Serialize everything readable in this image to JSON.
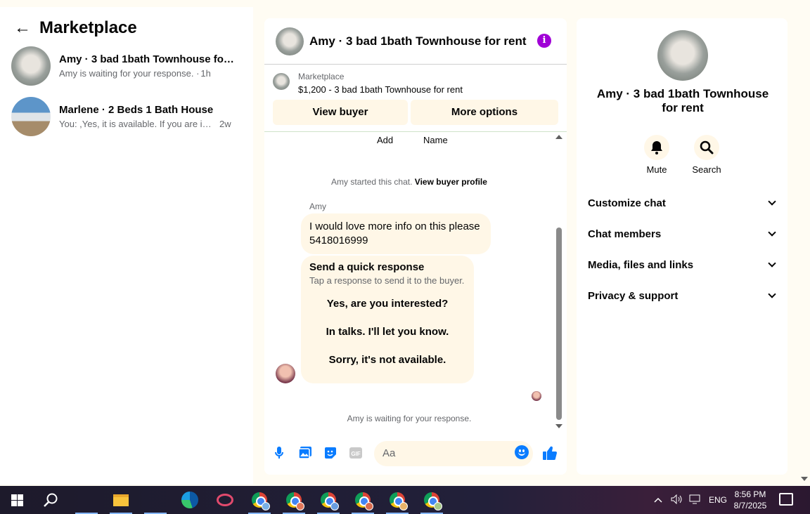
{
  "sidebar": {
    "title": "Marketplace",
    "conversations": [
      {
        "title": "Amy · 3 bad 1bath Townhouse for ...",
        "snippet": "Amy is waiting for your response. ·",
        "ago": "1h"
      },
      {
        "title": "Marlene · 2 Beds 1 Bath House",
        "snippet": "You: ,Yes, it is available. If you are inte...",
        "ago": "2w"
      }
    ]
  },
  "chat": {
    "title": "Amy · 3 bad 1bath Townhouse for rent",
    "info_icon_glyph": "i",
    "marketplace_label": "Marketplace",
    "listing": "$1,200 - 3 bad 1bath Townhouse for rent",
    "view_buyer_label": "View buyer",
    "more_options_label": "More options",
    "col_add": "Add",
    "col_name": "Name",
    "started_text": "Amy started this chat.",
    "view_profile_link": "View buyer profile",
    "sender_name": "Amy",
    "message_line1": "I would love more info on this please",
    "message_line2": "5418016999",
    "quick_title": "Send a quick response",
    "quick_subtitle": "Tap a response to send it to the buyer.",
    "quick_options": [
      "Yes, are you interested?",
      "In talks. I'll let you know.",
      "Sorry, it's not available."
    ],
    "waiting_text": "Amy is waiting for your response.",
    "composer_placeholder": "Aa"
  },
  "info_panel": {
    "title": "Amy · 3 bad 1bath Townhouse for rent",
    "mute_label": "Mute",
    "search_label": "Search",
    "sections": [
      "Customize chat",
      "Chat members",
      "Media, files and links",
      "Privacy & support"
    ]
  },
  "taskbar": {
    "language": "ENG",
    "time": "8:56 PM",
    "date": "8/7/2025"
  },
  "colors": {
    "accent": "#0a7cff",
    "info_purple": "#a000d6",
    "page_background": "#fffcf3",
    "soft_bubble": "#fff7e7"
  },
  "icons": [
    "back-arrow-icon",
    "info-icon",
    "microphone-icon",
    "image-icon",
    "sticker-icon",
    "gif-icon",
    "emoji-icon",
    "thumbs-up-icon",
    "bell-icon",
    "search-icon",
    "chevron-down-icon",
    "windows-icon",
    "chrome-icon",
    "edge-icon",
    "file-explorer-icon"
  ]
}
